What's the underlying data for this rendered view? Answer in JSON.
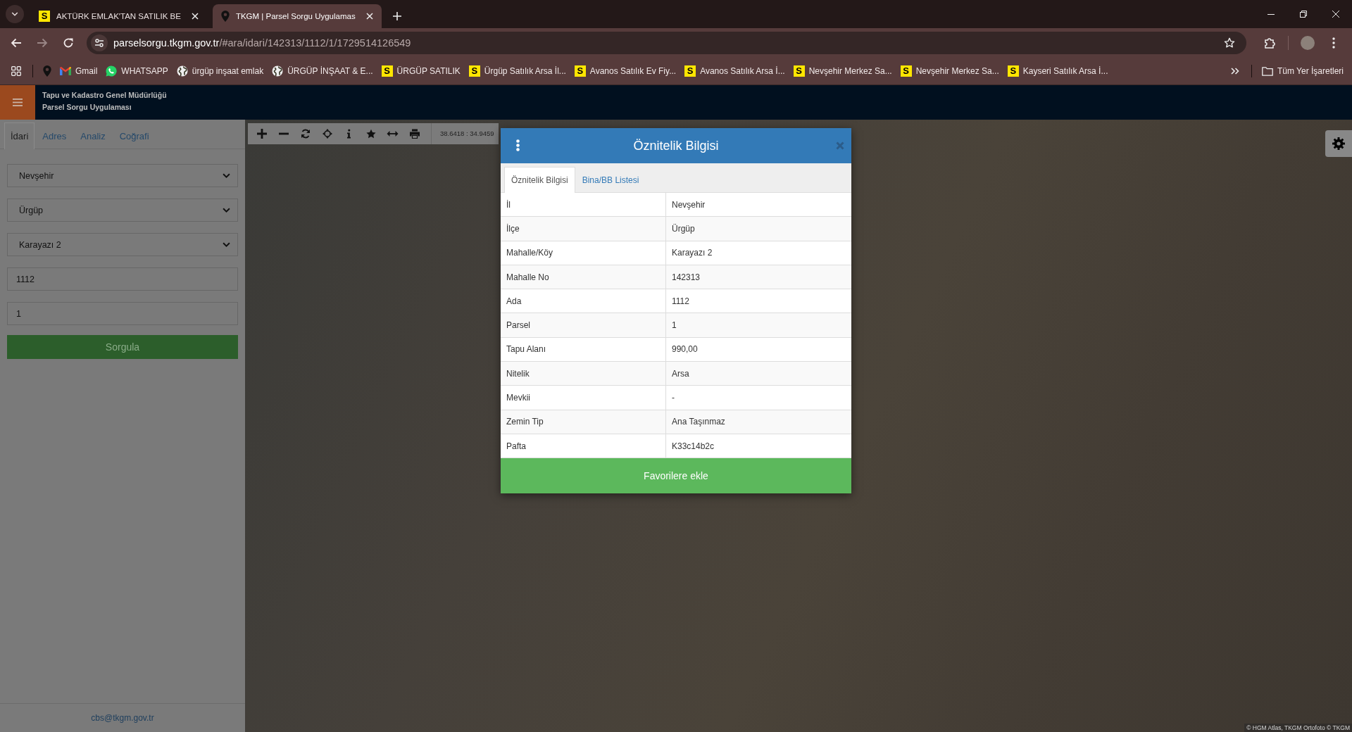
{
  "browser": {
    "tabs": [
      {
        "title": "AKTÜRK EMLAK'TAN SATILIK BE",
        "kind": "logo",
        "logo": "S",
        "selected": false
      },
      {
        "title": "TKGM | Parsel Sorgu Uygulamas",
        "kind": "pin",
        "selected": true
      }
    ],
    "nav": [
      {
        "kind": "back",
        "disabled": false
      },
      {
        "kind": "forward",
        "disabled": true
      },
      {
        "kind": "reload",
        "disabled": false
      }
    ],
    "address": {
      "host": "parselsorgu.tkgm.gov.tr",
      "path": "/#ara/idari/142313/1112/1/1729514126549"
    },
    "bookmarks": [
      {
        "kind": "pin"
      },
      {
        "kind": "gmail",
        "label": "Gmail"
      },
      {
        "kind": "whatsapp",
        "label": "WHATSAPP"
      },
      {
        "kind": "globe",
        "label": "ürgüp inşaat emlak"
      },
      {
        "kind": "globe",
        "label": "ÜRGÜP İNŞAAT & E..."
      },
      {
        "kind": "logo",
        "logo": "S",
        "label": "ÜRGÜP SATILIK"
      },
      {
        "kind": "logo",
        "logo": "S",
        "label": "Ürgüp Satılık Arsa İl..."
      },
      {
        "kind": "logo",
        "logo": "S",
        "label": "Avanos Satılık Ev Fiy..."
      },
      {
        "kind": "logo",
        "logo": "S",
        "label": "Avanos Satılık Arsa İ..."
      },
      {
        "kind": "logo",
        "logo": "S",
        "label": "Nevşehir Merkez Sa..."
      },
      {
        "kind": "logo",
        "logo": "S",
        "label": "Nevşehir Merkez Sa..."
      },
      {
        "kind": "logo",
        "logo": "S",
        "label": "Kayseri Satılık Arsa İ..."
      }
    ],
    "all_bookmarks": "Tüm Yer İşaretleri"
  },
  "header": {
    "title": "Tapu ve Kadastro Genel Müdürlüğü",
    "subtitle": "Parsel Sorgu Uygulaması"
  },
  "sidebar": {
    "tabs": [
      {
        "label": "İdari",
        "selected": true
      },
      {
        "label": "Adres",
        "selected": false
      },
      {
        "label": "Analiz",
        "selected": false
      },
      {
        "label": "Coğrafi",
        "selected": false
      }
    ],
    "fields": [
      {
        "kind": "select",
        "value": "Nevşehir"
      },
      {
        "kind": "select",
        "value": "Ürgüp"
      },
      {
        "kind": "select",
        "value": "Karayazı 2"
      },
      {
        "kind": "input",
        "value": "1112"
      },
      {
        "kind": "input",
        "value": "1"
      }
    ],
    "submit": "Sorgula",
    "footer": "cbs@tkgm.gov.tr"
  },
  "map": {
    "coordinates": "38.6418 : 34.9459",
    "attribution": "© HGM Atlas, TKGM Ortofoto © TKGM"
  },
  "dialog": {
    "title": "Öznitelik Bilgisi",
    "tabs": [
      {
        "label": "Öznitelik Bilgisi",
        "selected": true
      },
      {
        "label": "Bina/BB Listesi",
        "selected": false
      }
    ],
    "rows": [
      {
        "label": "İl",
        "value": "Nevşehir"
      },
      {
        "label": "İlçe",
        "value": "Ürgüp"
      },
      {
        "label": "Mahalle/Köy",
        "value": "Karayazı 2"
      },
      {
        "label": "Mahalle No",
        "value": "142313"
      },
      {
        "label": "Ada",
        "value": "1112"
      },
      {
        "label": "Parsel",
        "value": "1"
      },
      {
        "label": "Tapu Alanı",
        "value": "990,00"
      },
      {
        "label": "Nitelik",
        "value": "Arsa"
      },
      {
        "label": "Mevkii",
        "value": "-"
      },
      {
        "label": "Zemin Tip",
        "value": "Ana Taşınmaz"
      },
      {
        "label": "Pafta",
        "value": "K33c14b2c"
      }
    ],
    "button": "Favorilere ekle"
  }
}
